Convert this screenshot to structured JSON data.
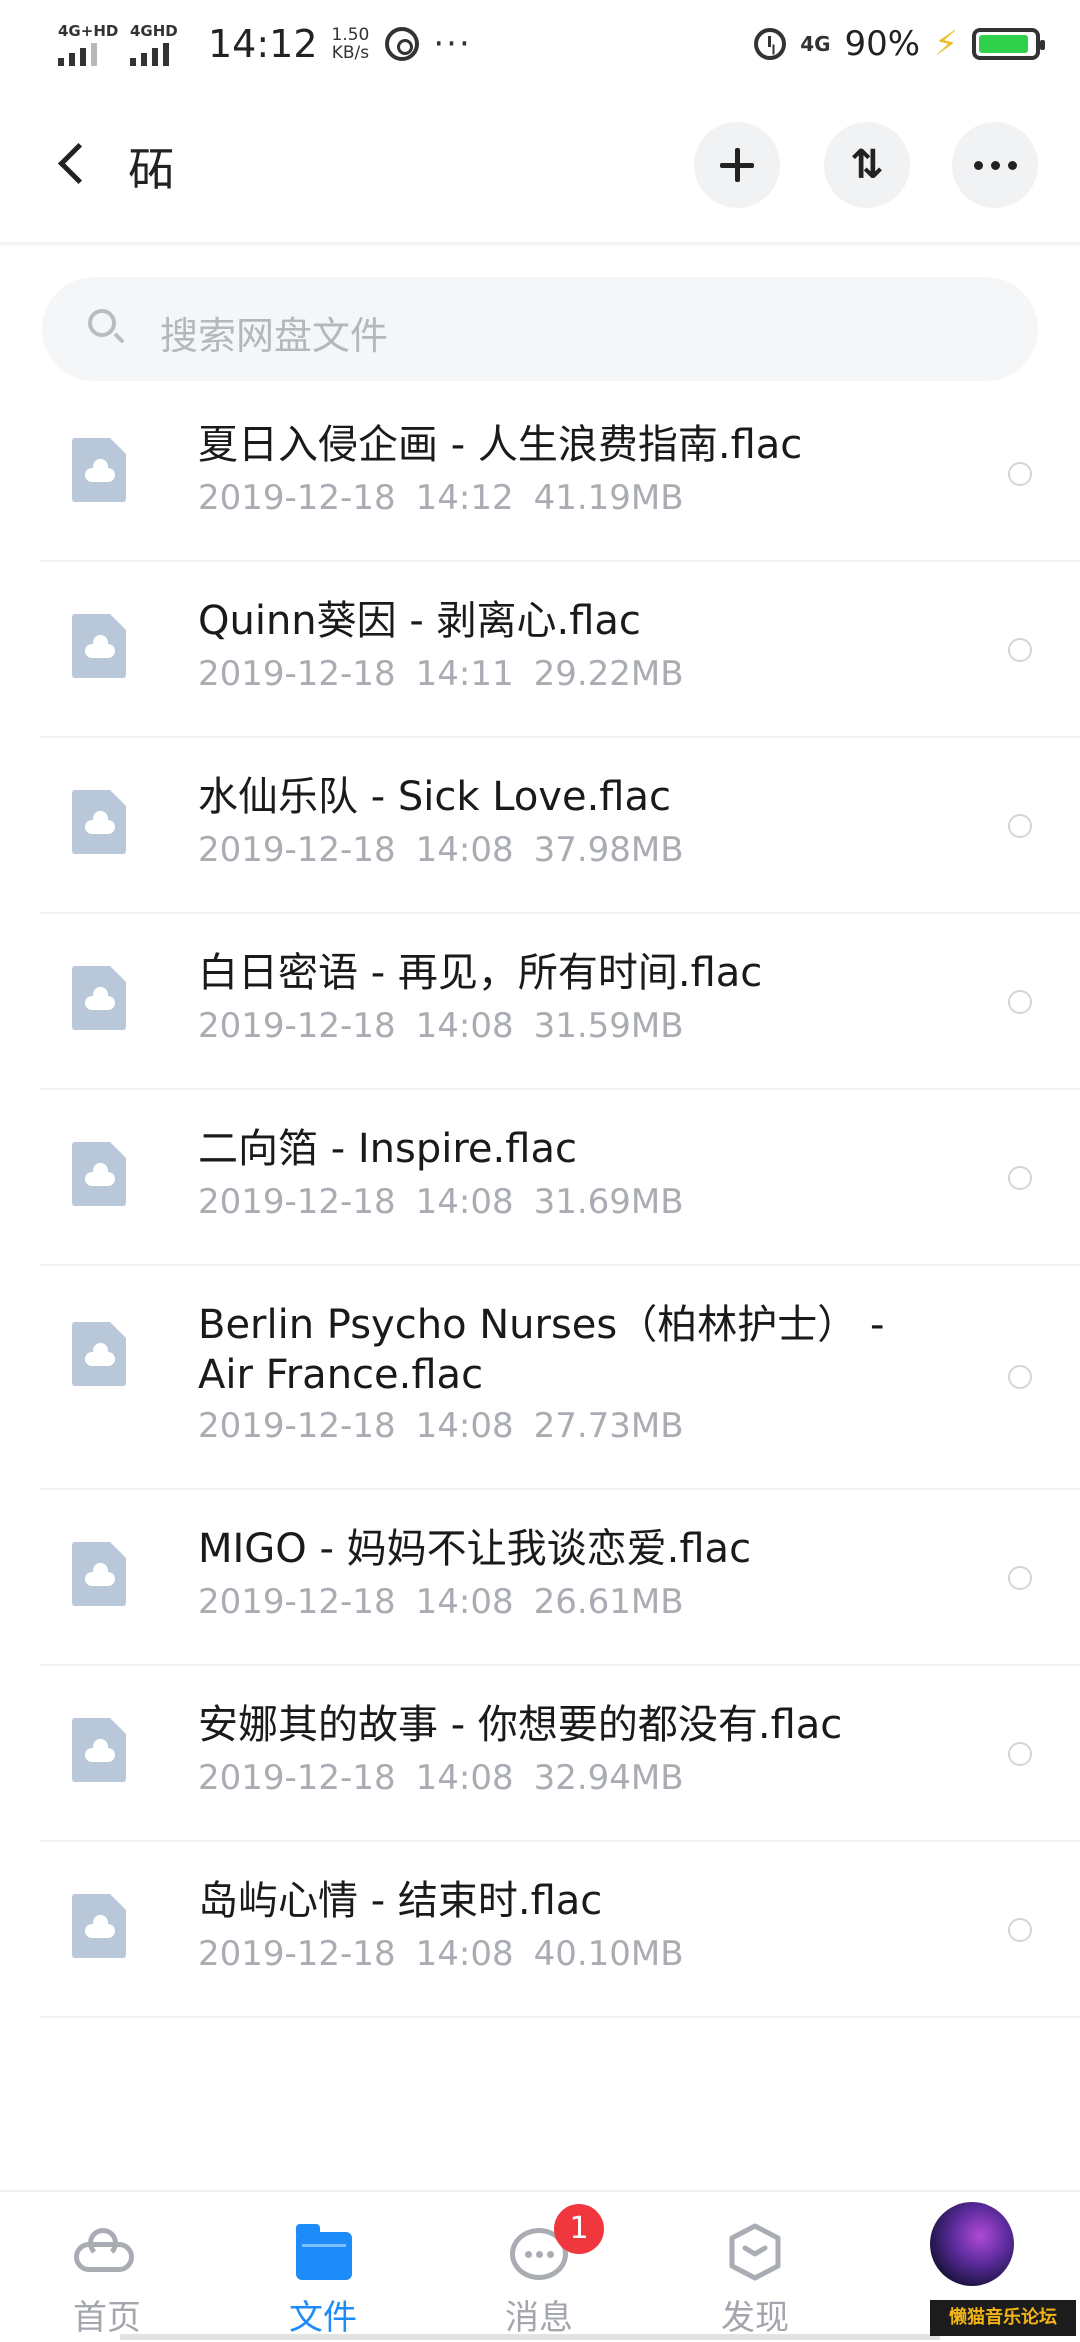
{
  "status_bar": {
    "sig1_label": "4G+HD",
    "sig2_label": "4GHD",
    "time": "14:12",
    "speed_value": "1.50",
    "speed_unit": "KB/s",
    "more": "···",
    "net": "4G",
    "battery": "90%"
  },
  "header": {
    "title": "砳",
    "sort_glyph": "⇅"
  },
  "search": {
    "placeholder": "搜索网盘文件"
  },
  "files": [
    {
      "name": "夏日入侵企画 - 人生浪费指南.flac",
      "date": "2019-12-18",
      "time": "14:12",
      "size": "41.19MB"
    },
    {
      "name": "Quinn葵因 - 剥离心.flac",
      "date": "2019-12-18",
      "time": "14:11",
      "size": "29.22MB"
    },
    {
      "name": "水仙乐队 - Sick Love.flac",
      "date": "2019-12-18",
      "time": "14:08",
      "size": "37.98MB"
    },
    {
      "name": "白日密语 - 再见，所有时间.flac",
      "date": "2019-12-18",
      "time": "14:08",
      "size": "31.59MB"
    },
    {
      "name": "二向箔 - Inspire.flac",
      "date": "2019-12-18",
      "time": "14:08",
      "size": "31.69MB"
    },
    {
      "name": "Berlin Psycho Nurses（柏林护士） - Air France.flac",
      "date": "2019-12-18",
      "time": "14:08",
      "size": "27.73MB"
    },
    {
      "name": "MIGO - 妈妈不让我谈恋爱.flac",
      "date": "2019-12-18",
      "time": "14:08",
      "size": "26.61MB"
    },
    {
      "name": "安娜其的故事 - 你想要的都没有.flac",
      "date": "2019-12-18",
      "time": "14:08",
      "size": "32.94MB"
    },
    {
      "name": "岛屿心情 - 结束时.flac",
      "date": "2019-12-18",
      "time": "14:08",
      "size": "40.10MB"
    }
  ],
  "nav": {
    "home": "首页",
    "files": "文件",
    "messages": "消息",
    "messages_badge": "1",
    "discover": "发现"
  },
  "watermark": "懒猫音乐论坛",
  "colors": {
    "accent": "#1d8cf8",
    "badge": "#f0373d",
    "battery": "#2fd04c"
  }
}
